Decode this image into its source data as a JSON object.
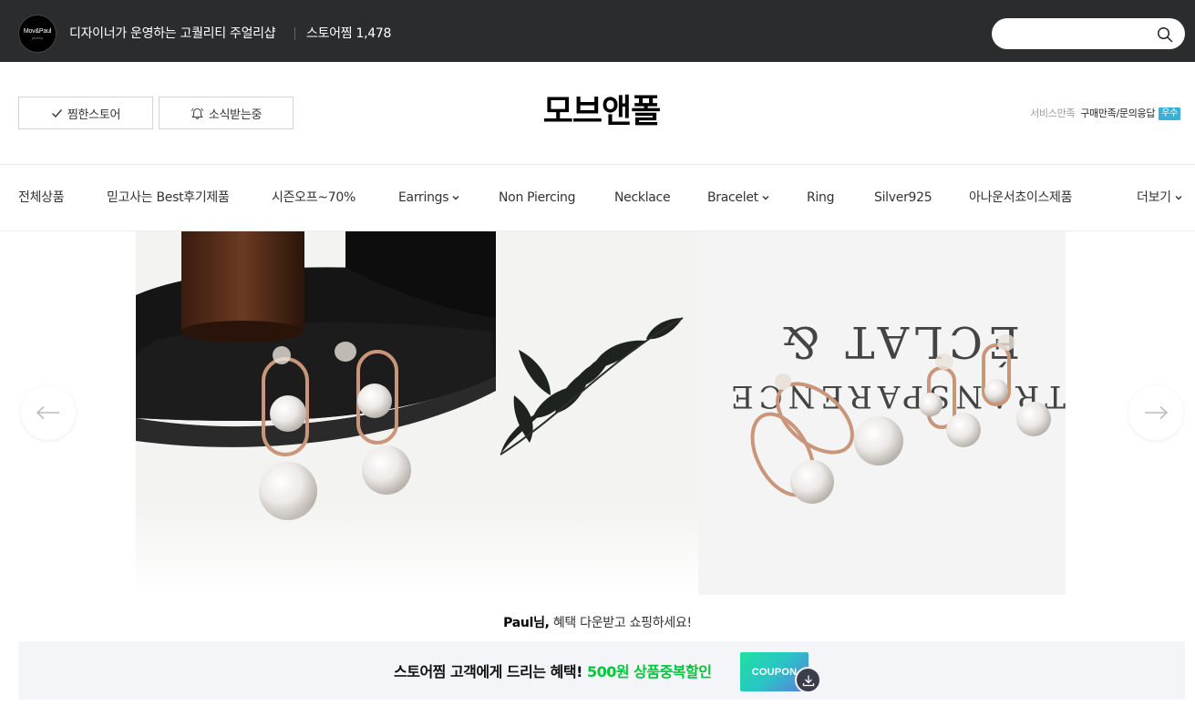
{
  "topbar": {
    "logo_text": "Mov&Paul",
    "logo_sub": "jewelry",
    "tagline": "디자이너가 운영하는 고퀄리티 주얼리샵",
    "storezzim_label": "스토어찜 1,478",
    "search": {
      "value": "",
      "placeholder": ""
    }
  },
  "header": {
    "zzim_button": "찜한스토어",
    "alarm_button": "소식받는중",
    "store_name": "모브앤폴",
    "service_label": "서비스만족",
    "service_value": "구매만족/문의응답",
    "service_badge": "우수"
  },
  "nav": {
    "items": [
      {
        "label": "전체상품"
      },
      {
        "label": "믿고사는 Best후기제품"
      },
      {
        "label": "시즌오프~70%"
      },
      {
        "label": "Earrings"
      },
      {
        "label": "Non Piercing"
      },
      {
        "label": "Necklace"
      },
      {
        "label": "Bracelet"
      },
      {
        "label": "Ring"
      },
      {
        "label": "Silver925"
      },
      {
        "label": "아나운서쵸이스제품"
      }
    ],
    "more_label": "더보기"
  },
  "banner": {
    "left_image": "pearl-earrings-on-black-stand",
    "right_image": "pearl-hoop-earrings-on-magazine",
    "magazine_text_1": "ÉCLAT &",
    "magazine_text_2": "TRANSPARENCE"
  },
  "greeting": {
    "user": "Paul님,",
    "message": " 혜택 다운받고 쇼핑하세요!"
  },
  "coupon": {
    "text_prefix": "스토어찜 고객에게 드리는 혜택! ",
    "text_highlight": "500원 상품중복할인",
    "chip_label": "COUPON"
  },
  "colors": {
    "topbar_bg": "#2b2c2e",
    "accent_green": "#00c73c",
    "badge_blue": "#3ab0d8"
  }
}
